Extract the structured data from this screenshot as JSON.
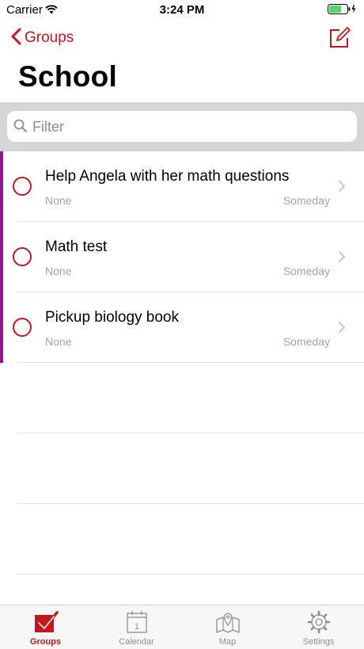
{
  "status_bar": {
    "carrier": "Carrier",
    "time": "3:24 PM"
  },
  "nav": {
    "back_label": "Groups",
    "title": "School"
  },
  "filter": {
    "placeholder": "Filter",
    "value": ""
  },
  "tasks": [
    {
      "title": "Help Angela with her math questions",
      "priority": "None",
      "date": "Someday"
    },
    {
      "title": "Math test",
      "priority": "None",
      "date": "Someday"
    },
    {
      "title": "Pickup biology book",
      "priority": "None",
      "date": "Someday"
    }
  ],
  "tab_bar": {
    "groups": "Groups",
    "calendar": "Calendar",
    "calendar_day": "1",
    "map": "Map",
    "settings": "Settings"
  },
  "colors": {
    "accent": "#c4161c",
    "group_color": "#8b1a8c"
  }
}
